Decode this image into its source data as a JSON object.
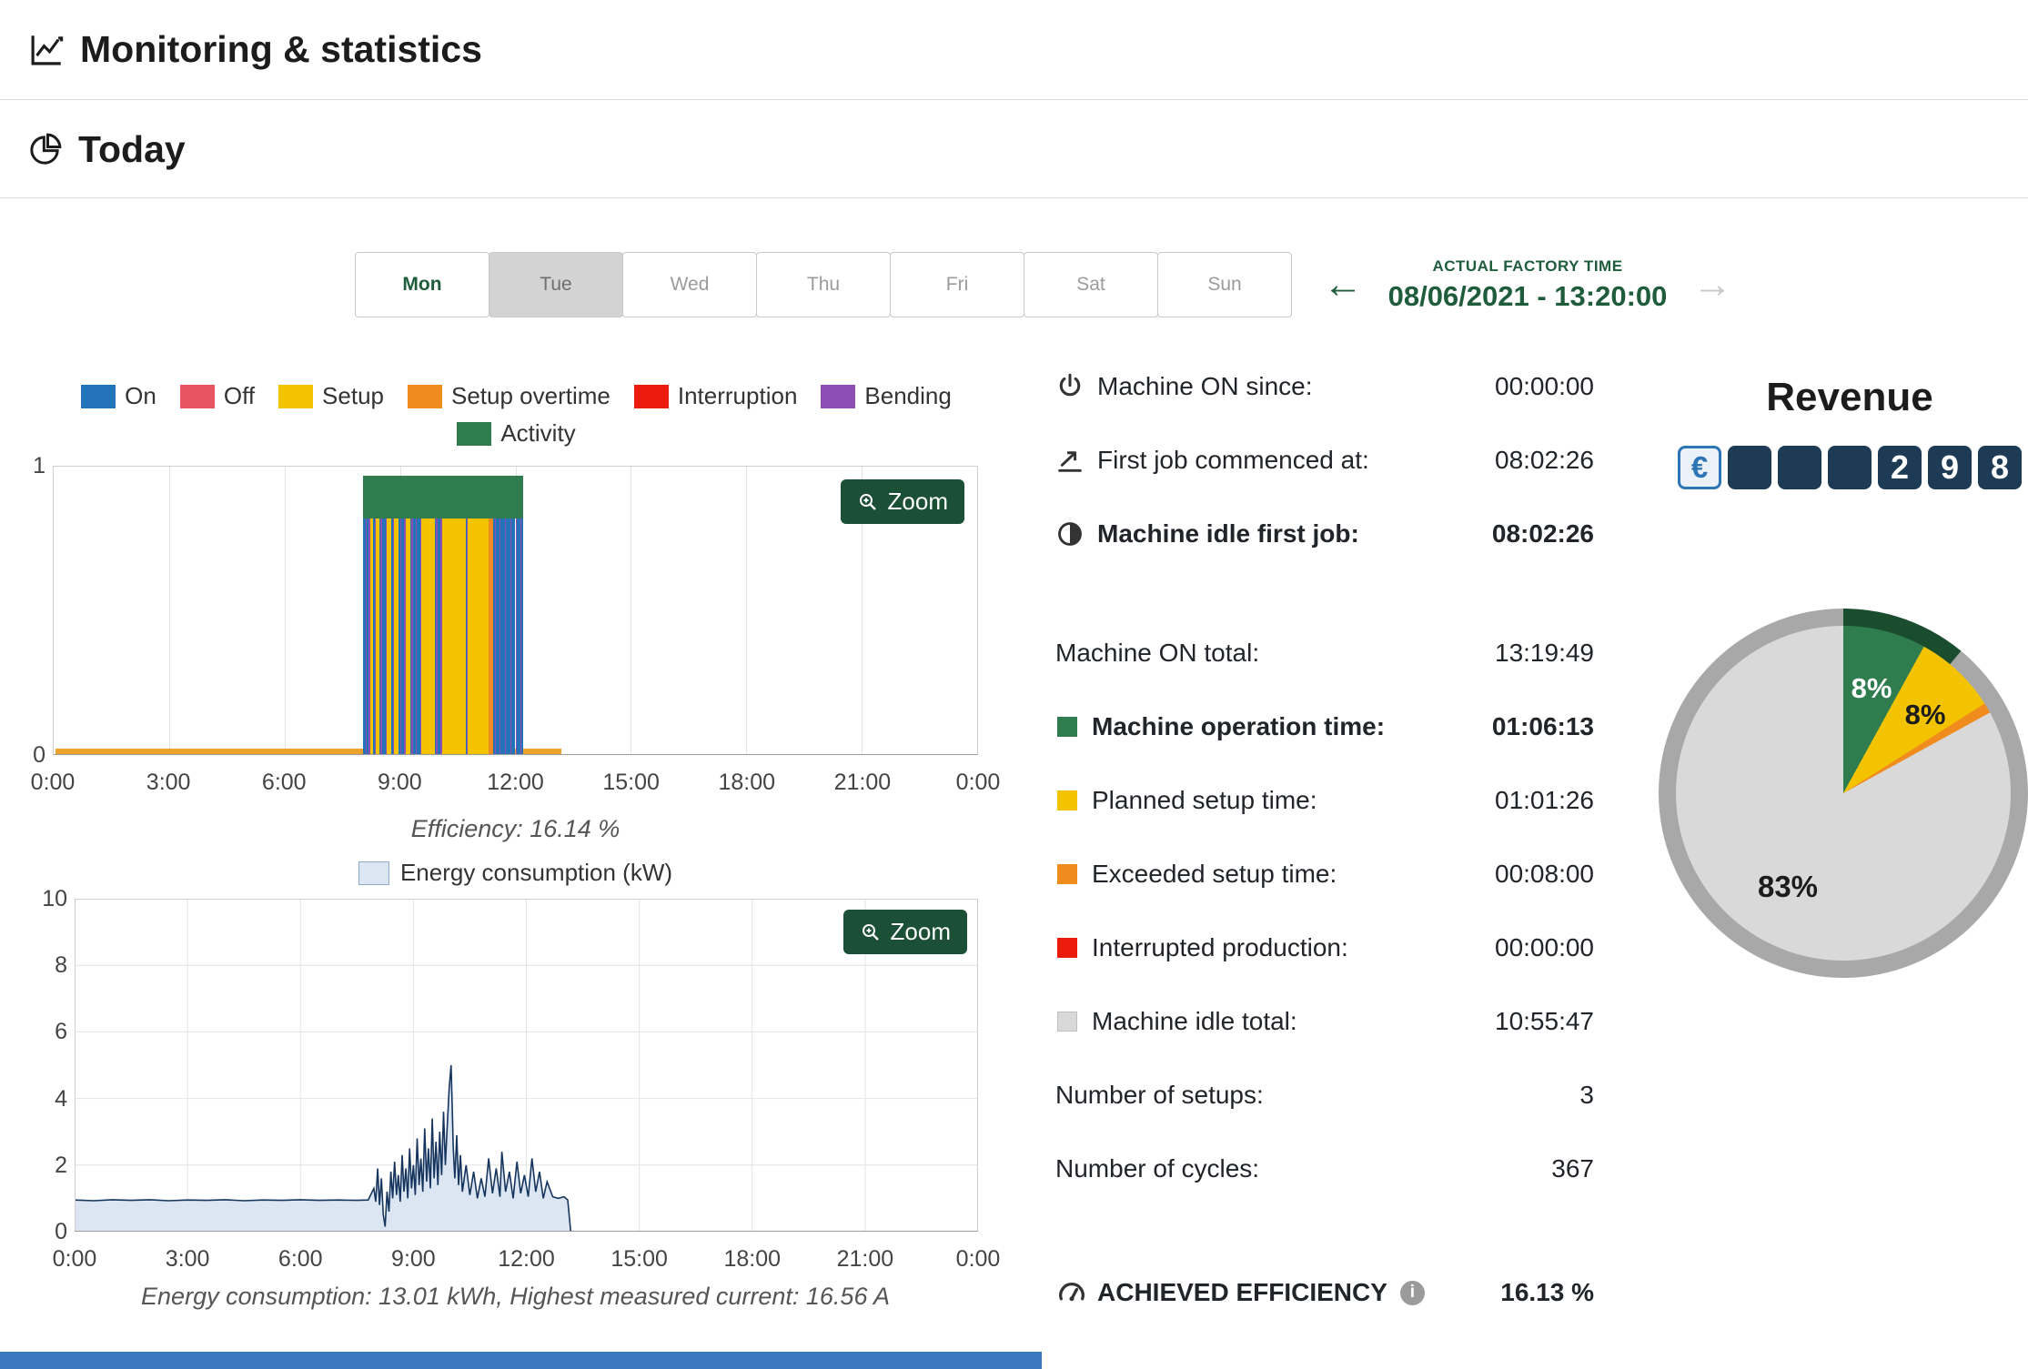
{
  "colors": {
    "accent_green": "#1e5c3c",
    "zoom_bg": "#1b5036",
    "on": "#2273b8",
    "off": "#e85461",
    "setup": "#f3c300",
    "overtime": "#f08c1e",
    "interruption": "#ec1c0c",
    "bending": "#8d4fb3",
    "activity": "#2f7d4f",
    "idle": "#d9d9d9",
    "energy_line": "#16355e",
    "energy_fill": "#dce6f3",
    "ring_gray": "#a8a8a8",
    "ring_green": "#1a4d2e",
    "footer_blue": "#3c78bd",
    "counter_box": "#1d3b55",
    "counter_border": "#2e75b6"
  },
  "header": {
    "title": "Monitoring & statistics"
  },
  "section": {
    "title": "Today"
  },
  "day_tabs": [
    {
      "label": "Mon",
      "state": "past"
    },
    {
      "label": "Tue",
      "state": "selected"
    },
    {
      "label": "Wed",
      "state": "future"
    },
    {
      "label": "Thu",
      "state": "future"
    },
    {
      "label": "Fri",
      "state": "future"
    },
    {
      "label": "Sat",
      "state": "future"
    },
    {
      "label": "Sun",
      "state": "future"
    }
  ],
  "factory_time": {
    "label": "ACTUAL FACTORY TIME",
    "value": "08/06/2021 - 13:20:00"
  },
  "zoom_label": "Zoom",
  "captions": {
    "efficiency": "Efficiency: 16.14 %",
    "energy": "Energy consumption: 13.01 kWh, Highest measured current: 16.56 A",
    "energy_legend": "Energy consumption (kW)"
  },
  "legend": [
    {
      "label": "On",
      "key": "on"
    },
    {
      "label": "Off",
      "key": "off"
    },
    {
      "label": "Setup",
      "key": "setup"
    },
    {
      "label": "Setup overtime",
      "key": "overtime"
    },
    {
      "label": "Interruption",
      "key": "interruption"
    },
    {
      "label": "Bending",
      "key": "bending"
    },
    {
      "label": "Activity",
      "key": "activity"
    }
  ],
  "stats": {
    "rows": [
      {
        "icon": "power-icon",
        "label": "Machine ON since:",
        "value": "00:00:00"
      },
      {
        "icon": "takeoff-icon",
        "label": "First job commenced at:",
        "value": "08:02:26"
      },
      {
        "icon": "idle-clock-icon",
        "label": "Machine idle first job:",
        "value": "08:02:26",
        "bold": true
      },
      {
        "label": "Machine ON total:",
        "value": "13:19:49",
        "gap_before": true
      },
      {
        "swatch": "activity",
        "label": "Machine operation time:",
        "value": "01:06:13",
        "bold": true
      },
      {
        "swatch": "setup",
        "label": "Planned setup time:",
        "value": "01:01:26"
      },
      {
        "swatch": "overtime",
        "label": "Exceeded setup time:",
        "value": "00:08:00"
      },
      {
        "swatch": "interruption",
        "label": "Interrupted production:",
        "value": "00:00:00"
      },
      {
        "swatch": "idle",
        "label": "Machine idle total:",
        "value": "10:55:47"
      },
      {
        "label": "Number of setups:",
        "value": "3"
      },
      {
        "label": "Number of cycles:",
        "value": "367"
      }
    ],
    "efficiency": {
      "label": "ACHIEVED EFFICIENCY",
      "value": "16.13 %"
    }
  },
  "revenue": {
    "title": "Revenue",
    "currency": "€",
    "digits": [
      "",
      "",
      "",
      "2",
      "9",
      "8"
    ]
  },
  "chart_data": [
    {
      "type": "bar",
      "name": "activity-timeline",
      "xlim": [
        0,
        24
      ],
      "ylim": [
        0,
        1
      ],
      "x_ticks": [
        "0:00",
        "3:00",
        "6:00",
        "9:00",
        "12:00",
        "15:00",
        "18:00",
        "21:00",
        "0:00"
      ],
      "y_ticks": [
        0,
        1
      ],
      "segments": [
        [
          8.05,
          8.1,
          "on"
        ],
        [
          8.1,
          8.13,
          "bending"
        ],
        [
          8.13,
          8.19,
          "on"
        ],
        [
          8.19,
          8.22,
          "bending"
        ],
        [
          8.22,
          8.3,
          "setup"
        ],
        [
          8.3,
          8.34,
          "on"
        ],
        [
          8.34,
          8.37,
          "bending"
        ],
        [
          8.37,
          8.46,
          "setup"
        ],
        [
          8.46,
          8.5,
          "on"
        ],
        [
          8.5,
          8.53,
          "bending"
        ],
        [
          8.53,
          8.62,
          "on"
        ],
        [
          8.62,
          8.66,
          "bending"
        ],
        [
          8.66,
          8.78,
          "setup"
        ],
        [
          8.78,
          8.82,
          "on"
        ],
        [
          8.82,
          8.85,
          "bending"
        ],
        [
          8.85,
          8.95,
          "setup"
        ],
        [
          8.95,
          9.0,
          "on"
        ],
        [
          9.0,
          9.03,
          "bending"
        ],
        [
          9.03,
          9.1,
          "on"
        ],
        [
          9.1,
          9.14,
          "bending"
        ],
        [
          9.14,
          9.26,
          "setup"
        ],
        [
          9.26,
          9.3,
          "on"
        ],
        [
          9.3,
          9.33,
          "bending"
        ],
        [
          9.33,
          9.4,
          "on"
        ],
        [
          9.4,
          9.44,
          "bending"
        ],
        [
          9.44,
          9.52,
          "on"
        ],
        [
          9.52,
          9.55,
          "bending"
        ],
        [
          9.55,
          9.9,
          "setup"
        ],
        [
          9.9,
          9.94,
          "on"
        ],
        [
          9.94,
          9.97,
          "bending"
        ],
        [
          9.97,
          10.05,
          "on"
        ],
        [
          10.05,
          10.1,
          "bending"
        ],
        [
          10.1,
          10.7,
          "setup"
        ],
        [
          10.7,
          10.74,
          "on"
        ],
        [
          10.74,
          10.77,
          "bending"
        ],
        [
          10.77,
          11.3,
          "setup"
        ],
        [
          11.3,
          11.43,
          "overtime"
        ],
        [
          11.43,
          11.47,
          "on"
        ],
        [
          11.47,
          11.5,
          "bending"
        ],
        [
          11.5,
          11.58,
          "on"
        ],
        [
          11.58,
          11.62,
          "bending"
        ],
        [
          11.62,
          11.72,
          "on"
        ],
        [
          11.72,
          11.76,
          "bending"
        ],
        [
          11.76,
          11.86,
          "on"
        ],
        [
          11.86,
          11.9,
          "bending"
        ],
        [
          11.9,
          12.0,
          "on"
        ],
        [
          12.0,
          12.04,
          "bending"
        ],
        [
          12.04,
          12.12,
          "on"
        ],
        [
          12.12,
          12.16,
          "bending"
        ],
        [
          12.16,
          12.2,
          "on"
        ]
      ],
      "activity_caps": [
        [
          8.05,
          12.2
        ]
      ],
      "baseline": {
        "x0": 0.05,
        "x1": 13.2,
        "color": "#eda22b"
      }
    },
    {
      "type": "area",
      "name": "energy-consumption",
      "xlim": [
        0,
        24
      ],
      "ylim": [
        0,
        10
      ],
      "x_ticks": [
        "0:00",
        "3:00",
        "6:00",
        "9:00",
        "12:00",
        "15:00",
        "18:00",
        "21:00",
        "0:00"
      ],
      "y_ticks": [
        0,
        2,
        4,
        6,
        8,
        10
      ],
      "series": [
        {
          "name": "Energy consumption (kW)",
          "points": [
            [
              0,
              0.95
            ],
            [
              0.5,
              0.93
            ],
            [
              1,
              0.96
            ],
            [
              1.5,
              0.94
            ],
            [
              2,
              0.96
            ],
            [
              2.5,
              0.93
            ],
            [
              3,
              0.95
            ],
            [
              3.5,
              0.94
            ],
            [
              4,
              0.96
            ],
            [
              4.5,
              0.93
            ],
            [
              5,
              0.95
            ],
            [
              5.5,
              0.94
            ],
            [
              6,
              0.96
            ],
            [
              6.5,
              0.94
            ],
            [
              7,
              0.95
            ],
            [
              7.5,
              0.94
            ],
            [
              7.8,
              0.95
            ],
            [
              7.95,
              1.3
            ],
            [
              8,
              0.9
            ],
            [
              8.05,
              1.9
            ],
            [
              8.1,
              0.8
            ],
            [
              8.15,
              1.6
            ],
            [
              8.2,
              0.5
            ],
            [
              8.25,
              0.15
            ],
            [
              8.3,
              1.2
            ],
            [
              8.35,
              0.6
            ],
            [
              8.4,
              1.8
            ],
            [
              8.45,
              1
            ],
            [
              8.5,
              2.1
            ],
            [
              8.55,
              1.1
            ],
            [
              8.6,
              1.7
            ],
            [
              8.65,
              0.9
            ],
            [
              8.7,
              2.3
            ],
            [
              8.75,
              1.2
            ],
            [
              8.8,
              1.9
            ],
            [
              8.85,
              1
            ],
            [
              8.9,
              2.5
            ],
            [
              8.95,
              1.3
            ],
            [
              9,
              2
            ],
            [
              9.05,
              1.1
            ],
            [
              9.1,
              2.8
            ],
            [
              9.15,
              1.4
            ],
            [
              9.2,
              2.2
            ],
            [
              9.25,
              1.2
            ],
            [
              9.3,
              3.1
            ],
            [
              9.35,
              1.5
            ],
            [
              9.4,
              2.5
            ],
            [
              9.45,
              1.3
            ],
            [
              9.5,
              3.4
            ],
            [
              9.55,
              1.6
            ],
            [
              9.6,
              2.7
            ],
            [
              9.65,
              1.4
            ],
            [
              9.7,
              3
            ],
            [
              9.75,
              1.7
            ],
            [
              9.8,
              3.6
            ],
            [
              9.85,
              2
            ],
            [
              9.9,
              3.2
            ],
            [
              9.95,
              4.3
            ],
            [
              10,
              5
            ],
            [
              10.03,
              3.8
            ],
            [
              10.06,
              2.5
            ],
            [
              10.1,
              1.6
            ],
            [
              10.15,
              2.9
            ],
            [
              10.2,
              1.4
            ],
            [
              10.25,
              2.3
            ],
            [
              10.3,
              1.2
            ],
            [
              10.4,
              2
            ],
            [
              10.5,
              1.1
            ],
            [
              10.6,
              1.8
            ],
            [
              10.7,
              1
            ],
            [
              10.8,
              1.6
            ],
            [
              10.9,
              1.05
            ],
            [
              11,
              2.2
            ],
            [
              11.1,
              1.15
            ],
            [
              11.2,
              1.9
            ],
            [
              11.3,
              1.05
            ],
            [
              11.35,
              2.4
            ],
            [
              11.45,
              1.2
            ],
            [
              11.55,
              1.8
            ],
            [
              11.65,
              1
            ],
            [
              11.75,
              2.1
            ],
            [
              11.85,
              1.15
            ],
            [
              11.95,
              1.7
            ],
            [
              12.05,
              1.05
            ],
            [
              12.15,
              2.2
            ],
            [
              12.25,
              1.2
            ],
            [
              12.35,
              1.8
            ],
            [
              12.45,
              1
            ],
            [
              12.55,
              1.5
            ],
            [
              12.7,
              1.05
            ],
            [
              12.85,
              1
            ],
            [
              13,
              1.05
            ],
            [
              13.1,
              0.95
            ],
            [
              13.18,
              0
            ]
          ]
        }
      ]
    },
    {
      "type": "pie",
      "name": "time-distribution",
      "slices": [
        {
          "label": "Machine operation time",
          "value": 8,
          "key": "activity",
          "text": "8%"
        },
        {
          "label": "Planned setup time",
          "value": 8,
          "key": "setup",
          "text": "8%"
        },
        {
          "label": "Exceeded setup time",
          "value": 1,
          "key": "overtime",
          "text": ""
        },
        {
          "label": "Machine idle total",
          "value": 83,
          "key": "idle",
          "text": "83%"
        }
      ],
      "ring": {
        "highlight_percent": 11
      }
    }
  ]
}
